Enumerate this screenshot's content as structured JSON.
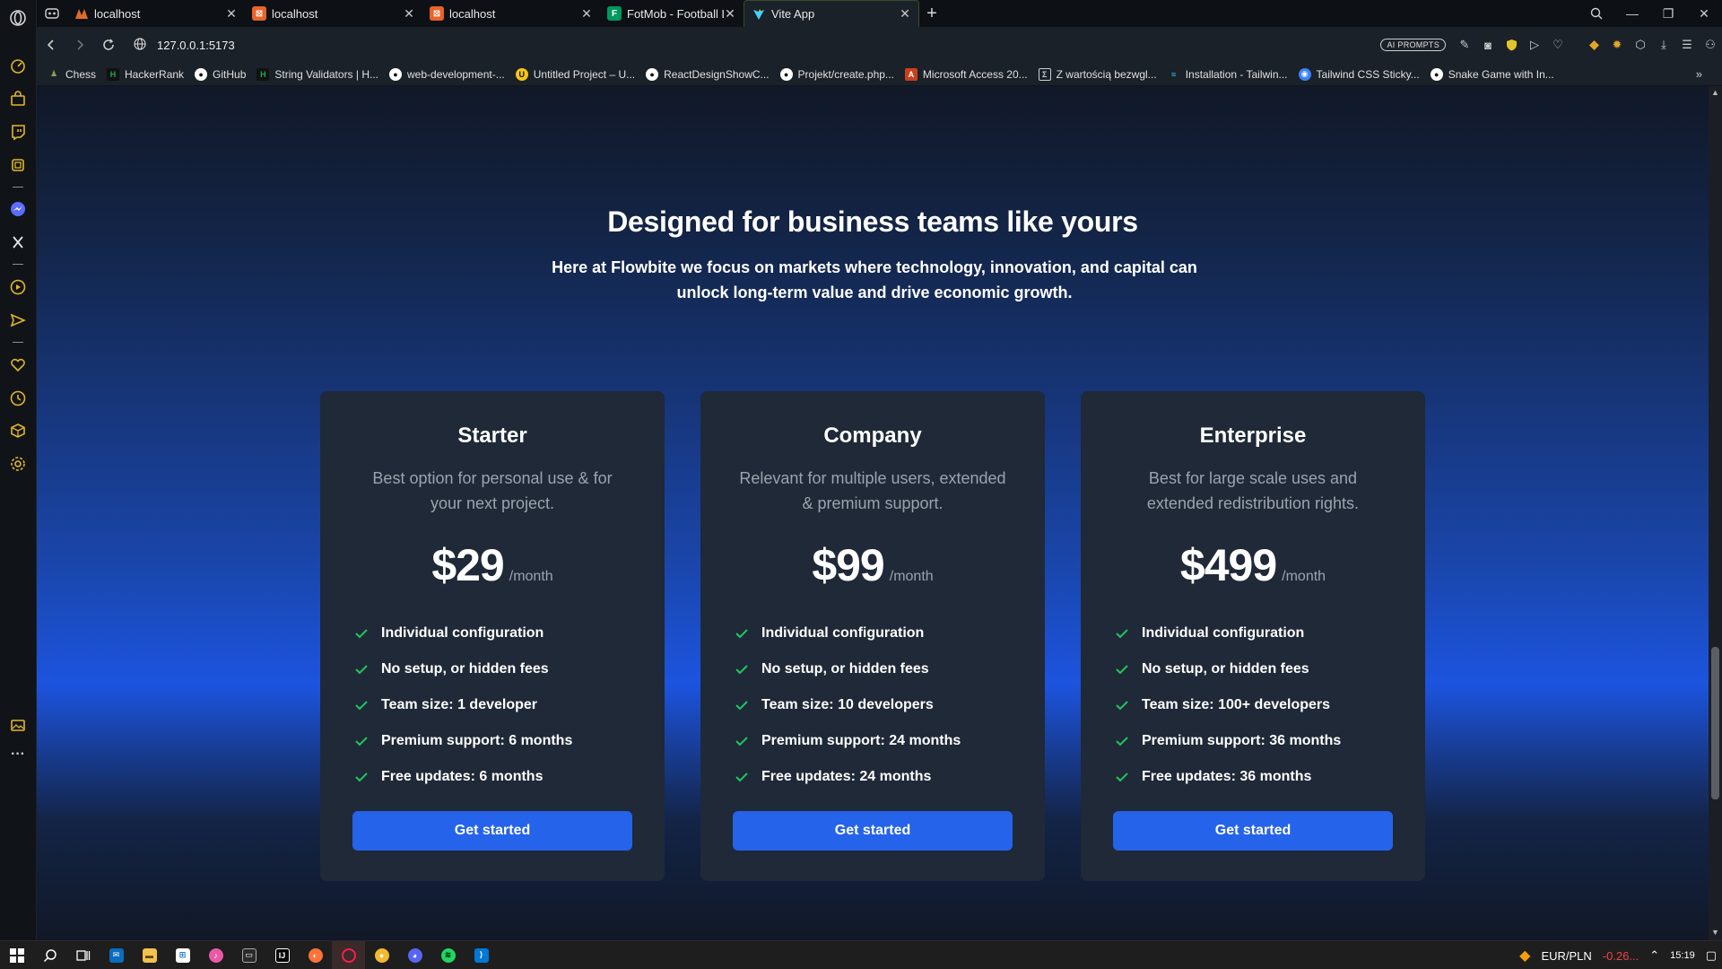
{
  "browser": {
    "tabs": [
      {
        "title": "localhost",
        "icon": "localhost-icon",
        "color": "#e06c2b"
      },
      {
        "title": "localhost",
        "icon": "localhost-icon",
        "color": "#e8632a"
      },
      {
        "title": "localhost",
        "icon": "localhost-icon",
        "color": "#e8632a"
      },
      {
        "title": "FotMob - Football Live Scores",
        "icon": "fotmob-icon",
        "color": "#00985f"
      },
      {
        "title": "Vite App",
        "icon": "vite-icon",
        "color": "#41d1ff",
        "active": true
      }
    ],
    "new_tab_label": "+",
    "url": "127.0.0.1:5173",
    "ai_prompts_label": "AI PROMPTS",
    "bookmarks": [
      {
        "label": "Chess",
        "color": "#7fa650"
      },
      {
        "label": "HackerRank",
        "color": "#1ba94c"
      },
      {
        "label": "GitHub",
        "color": "#ffffff"
      },
      {
        "label": "String Validators | H...",
        "color": "#1ba94c"
      },
      {
        "label": "web-development-...",
        "color": "#ffffff"
      },
      {
        "label": "Untitled Project – U...",
        "color": "#f5c518"
      },
      {
        "label": "ReactDesignShowC...",
        "color": "#ffffff"
      },
      {
        "label": "Projekt/create.php...",
        "color": "#ffffff"
      },
      {
        "label": "Microsoft Access 20...",
        "color": "#c8411c"
      },
      {
        "label": "Z wartością bezwgl...",
        "color": "#cccccc"
      },
      {
        "label": "Installation - Tailwin...",
        "color": "#38bdf8"
      },
      {
        "label": "Tailwind CSS Sticky...",
        "color": "#3b82f6"
      },
      {
        "label": "Snake Game with In...",
        "color": "#ffffff"
      }
    ],
    "bookmarks_more": "»"
  },
  "page": {
    "headline": "Designed for business teams like yours",
    "subline": "Here at Flowbite we focus on markets where technology, innovation, and capital can unlock long-term value and drive economic growth.",
    "plans": [
      {
        "name": "Starter",
        "description": "Best option for personal use & for your next project.",
        "price": "$29",
        "period": "/month",
        "features": [
          "Individual configuration",
          "No setup, or hidden fees",
          "Team size: 1 developer",
          "Premium support: 6 months",
          "Free updates: 6 months"
        ],
        "cta": "Get started"
      },
      {
        "name": "Company",
        "description": "Relevant for multiple users, extended & premium support.",
        "price": "$99",
        "period": "/month",
        "features": [
          "Individual configuration",
          "No setup, or hidden fees",
          "Team size: 10 developers",
          "Premium support: 24 months",
          "Free updates: 24 months"
        ],
        "cta": "Get started"
      },
      {
        "name": "Enterprise",
        "description": "Best for large scale uses and extended redistribution rights.",
        "price": "$499",
        "period": "/month",
        "features": [
          "Individual configuration",
          "No setup, or hidden fees",
          "Team size: 100+ developers",
          "Premium support: 36 months",
          "Free updates: 36 months"
        ],
        "cta": "Get started"
      }
    ],
    "accent_color": "#2563eb",
    "check_color": "#22c55e"
  },
  "taskbar": {
    "currency": "EUR/PLN",
    "currency_change": "-0.26...",
    "time": "15:19"
  }
}
